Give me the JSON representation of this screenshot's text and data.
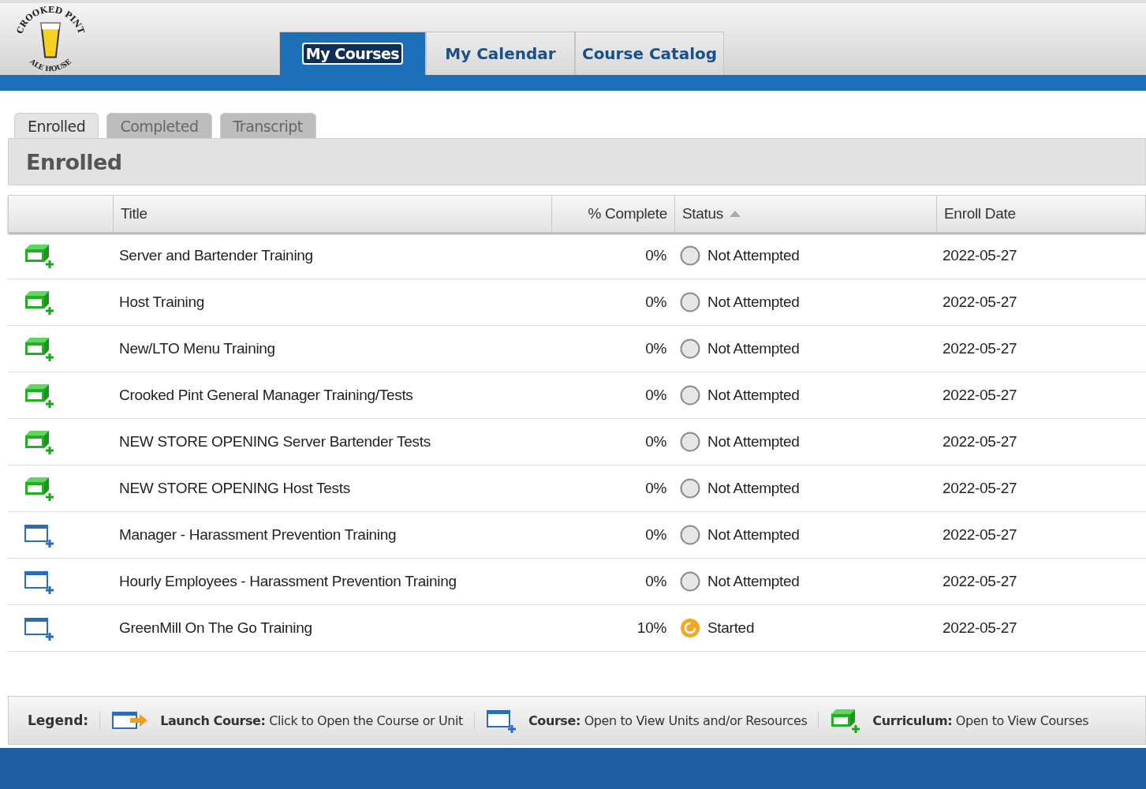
{
  "logo": {
    "top_text": "CROOKED PINT",
    "bottom_text": "ALE HOUSE"
  },
  "nav_tabs": [
    {
      "label": "My Courses",
      "selected": true
    },
    {
      "label": "My Calendar",
      "selected": false
    },
    {
      "label": "Course Catalog",
      "selected": false
    }
  ],
  "sub_tabs": [
    {
      "label": "Enrolled",
      "selected": true
    },
    {
      "label": "Completed",
      "selected": false
    },
    {
      "label": "Transcript",
      "selected": false
    }
  ],
  "panel_title": "Enrolled",
  "table": {
    "columns": [
      {
        "label": "Title"
      },
      {
        "label": "% Complete"
      },
      {
        "label": "Status",
        "sorted": true
      },
      {
        "label": "Enroll Date"
      }
    ],
    "rows": [
      {
        "kind": "curriculum",
        "title": "Server and Bartender Training",
        "percent": "0%",
        "status": {
          "kind": "not_attempted",
          "label": "Not Attempted"
        },
        "enroll_date": "2022-05-27"
      },
      {
        "kind": "curriculum",
        "title": "Host Training",
        "percent": "0%",
        "status": {
          "kind": "not_attempted",
          "label": "Not Attempted"
        },
        "enroll_date": "2022-05-27"
      },
      {
        "kind": "curriculum",
        "title": "New/LTO Menu Training",
        "percent": "0%",
        "status": {
          "kind": "not_attempted",
          "label": "Not Attempted"
        },
        "enroll_date": "2022-05-27"
      },
      {
        "kind": "curriculum",
        "title": "Crooked Pint General Manager Training/Tests",
        "percent": "0%",
        "status": {
          "kind": "not_attempted",
          "label": "Not Attempted"
        },
        "enroll_date": "2022-05-27"
      },
      {
        "kind": "curriculum",
        "title": "NEW STORE OPENING Server Bartender Tests",
        "percent": "0%",
        "status": {
          "kind": "not_attempted",
          "label": "Not Attempted"
        },
        "enroll_date": "2022-05-27"
      },
      {
        "kind": "curriculum",
        "title": "NEW STORE OPENING Host Tests",
        "percent": "0%",
        "status": {
          "kind": "not_attempted",
          "label": "Not Attempted"
        },
        "enroll_date": "2022-05-27"
      },
      {
        "kind": "course",
        "title": "Manager - Harassment Prevention Training",
        "percent": "0%",
        "status": {
          "kind": "not_attempted",
          "label": "Not Attempted"
        },
        "enroll_date": "2022-05-27"
      },
      {
        "kind": "course",
        "title": "Hourly Employees - Harassment Prevention Training",
        "percent": "0%",
        "status": {
          "kind": "not_attempted",
          "label": "Not Attempted"
        },
        "enroll_date": "2022-05-27"
      },
      {
        "kind": "course",
        "title": "GreenMill On The Go Training",
        "percent": "10%",
        "status": {
          "kind": "started",
          "label": "Started"
        },
        "enroll_date": "2022-05-27"
      }
    ]
  },
  "legend": {
    "label": "Legend:",
    "items": [
      {
        "kind": "launch",
        "term": "Launch Course:",
        "description": "Click to Open the Course or Unit"
      },
      {
        "kind": "course",
        "term": "Course:",
        "description": "Open to View Units and/or Resources"
      },
      {
        "kind": "curriculum",
        "term": "Curriculum:",
        "description": "Open to View Courses"
      }
    ]
  }
}
